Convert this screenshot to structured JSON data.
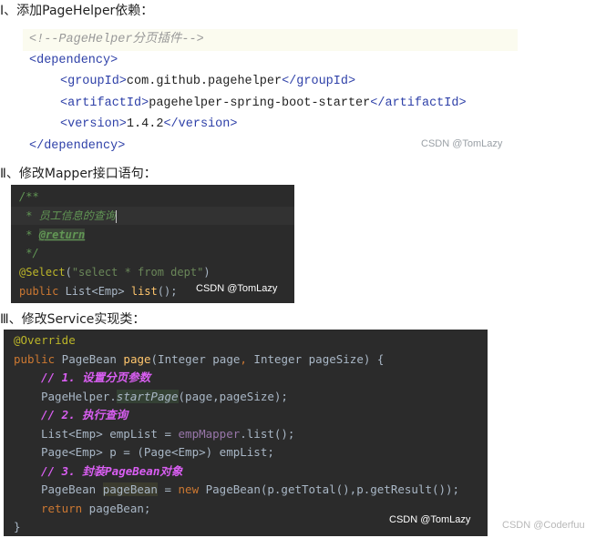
{
  "sections": {
    "one": "Ⅰ、添加PageHelper依赖：",
    "two": "Ⅱ、修改Mapper接口语句：",
    "three": "Ⅲ、修改Service实现类："
  },
  "xml": {
    "comment": "<!--PageHelper分页插件-->",
    "dep_open": "<dependency>",
    "group_open": "<groupId>",
    "group_value": "com.github.pagehelper",
    "group_close": "</groupId>",
    "artifact_open": "<artifactId>",
    "artifact_value": "pagehelper-spring-boot-starter",
    "artifact_close": "</artifactId>",
    "version_open": "<version>",
    "version_value": "1.4.2",
    "version_close": "</version>",
    "dep_close": "</dependency>"
  },
  "mapper": {
    "doc_open": "/**",
    "doc_line_prefix": " * ",
    "doc_line_text": "员工信息的查询",
    "doc_return_prefix": " * ",
    "doc_return_tag": "@return",
    "doc_close": " */",
    "annotation": "@Select",
    "paren_open": "(",
    "sql": "\"select * from dept\"",
    "paren_close": ")",
    "sig_kw": "public",
    "sig_type": " List<Emp> ",
    "sig_method": "list",
    "sig_end": "();"
  },
  "service": {
    "override": "@Override",
    "sig_kw": "public",
    "sig_type": " PageBean ",
    "sig_method": "page",
    "sig_params_a": "(Integer page",
    "sig_comma": ",",
    "sig_params_b": " Integer pageSize) {",
    "c1": "// 1. 设置分页参数",
    "l2_a": "PageHelper.",
    "l2_method": "startPage",
    "l2_b": "(page,pageSize);",
    "c2": "// 2. 执行查询",
    "l4_a": "List<Emp> empList = ",
    "l4_field": "empMapper",
    "l4_b": ".list();",
    "l5": "Page<Emp> p = (Page<Emp>) empList;",
    "c3": "// 3. 封装PageBean对象",
    "l7_a": "PageBean ",
    "l7_var": "pageBean",
    "l7_b": " = ",
    "l7_kw": "new",
    "l7_c": " PageBean(p.getTotal(),p.getResult());",
    "l8_kw": "return",
    "l8_b": " pageBean;",
    "close": "}"
  },
  "watermarks": {
    "block1": "CSDN @TomLazy",
    "block2": "CSDN @TomLazy",
    "block3": "CSDN @TomLazy",
    "page": "CSDN @Coderfuu"
  }
}
